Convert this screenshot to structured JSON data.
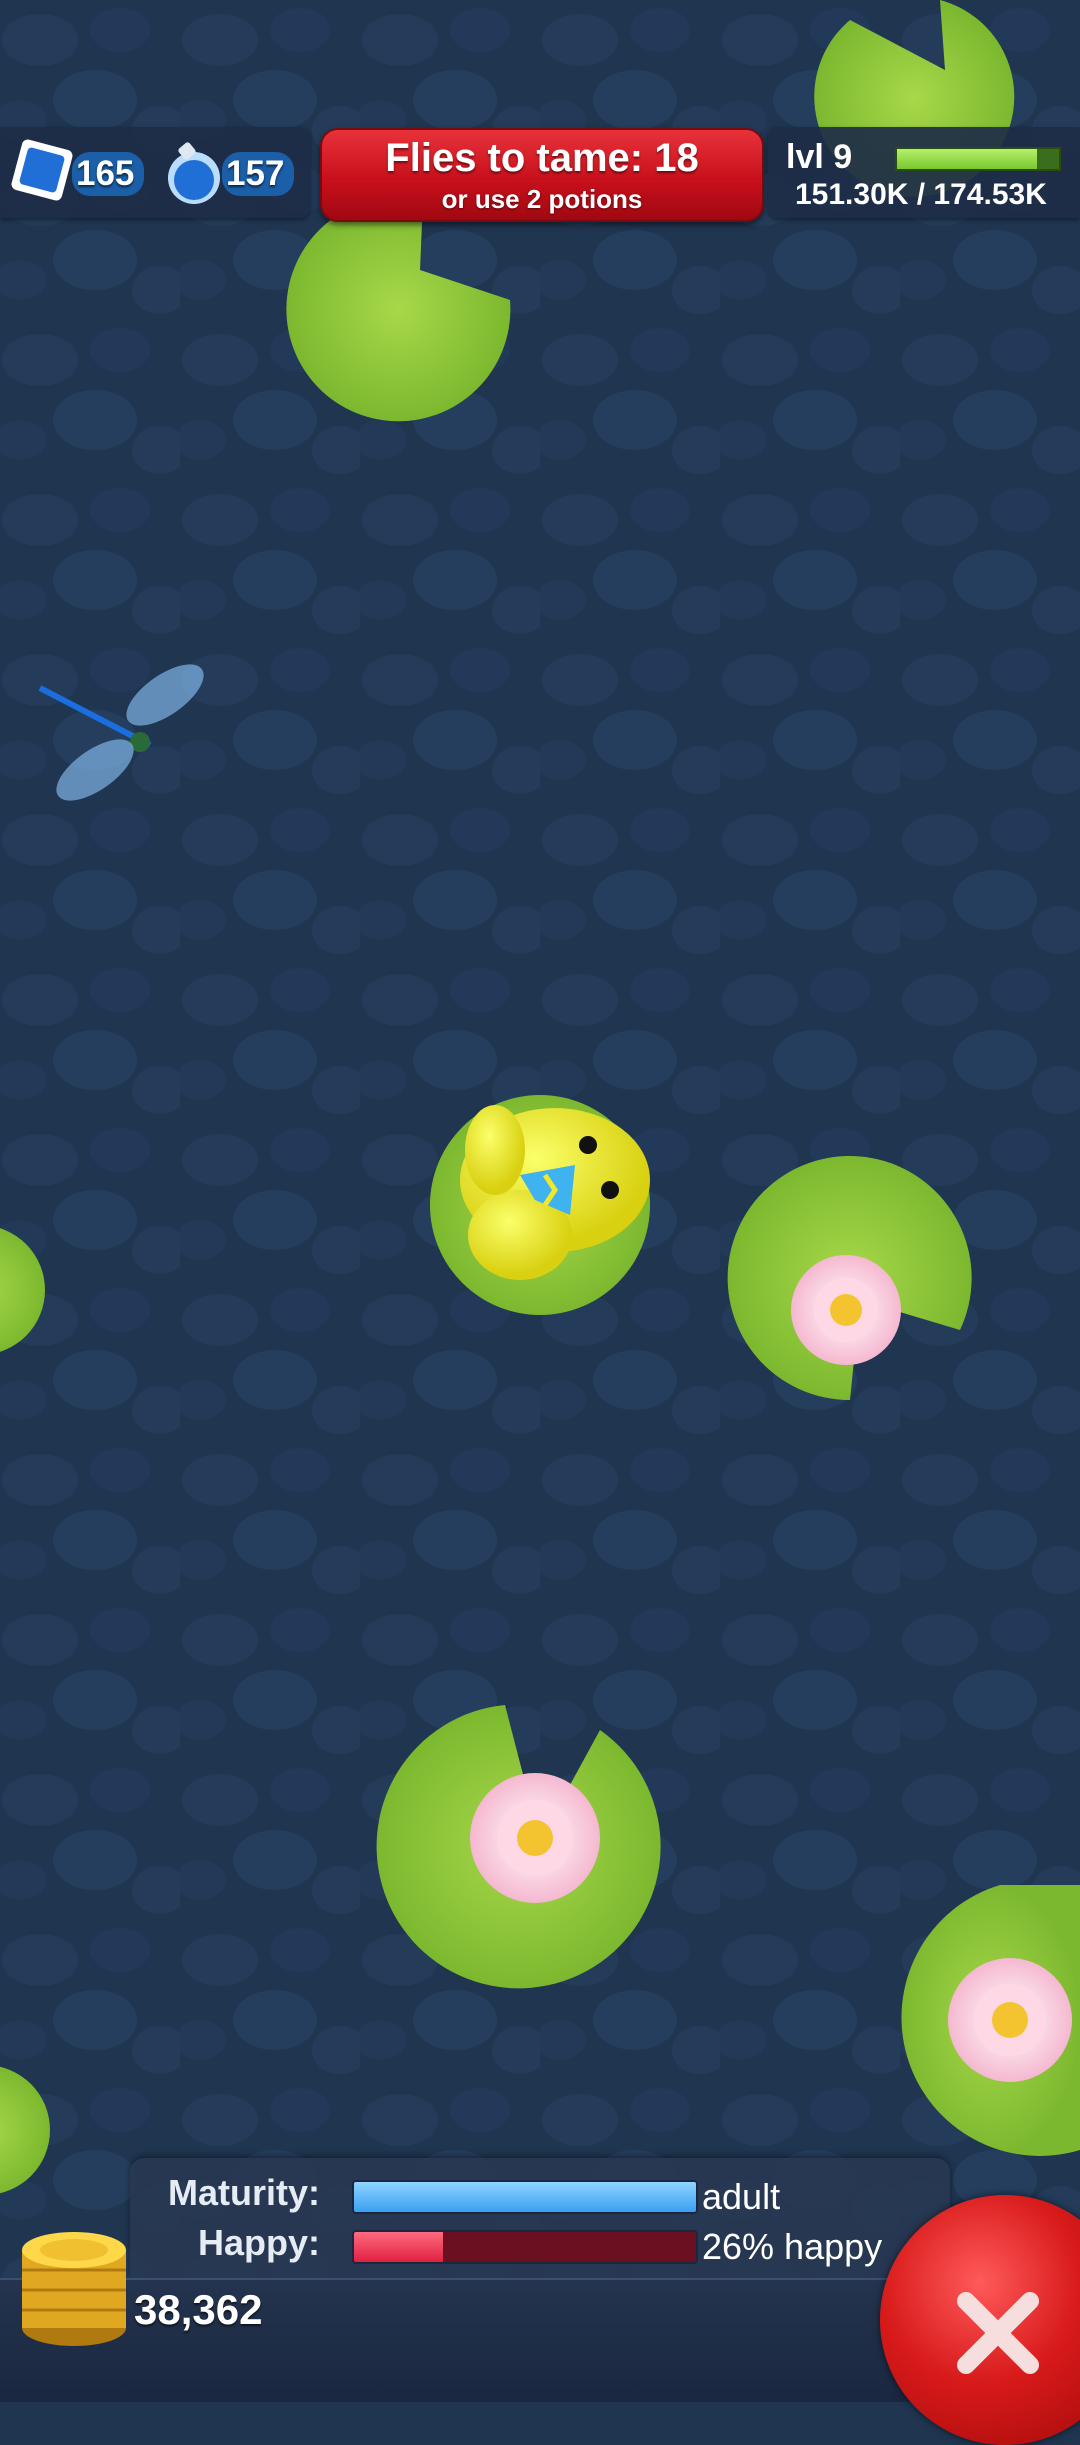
{
  "currency": {
    "gems": "165",
    "potions": "157"
  },
  "tame_banner": {
    "title": "Flies to tame: 18",
    "subtitle": "or use 2 potions",
    "color": "#d81a22"
  },
  "level": {
    "label": "lvl 9",
    "xp_text": "151.30K / 174.53K",
    "xp_progress": 0.867
  },
  "stats": {
    "maturity_label": "Maturity:",
    "maturity_value": "adult",
    "maturity_progress": 1.0,
    "happy_label": "Happy:",
    "happy_value": "26% happy",
    "happy_progress": 0.26
  },
  "coins": {
    "count": "38,362"
  },
  "icons": {
    "gem": "blue-gem-icon",
    "potion": "potion-bottle-icon",
    "coins": "gold-coin-stack-icon",
    "close": "close-x-icon"
  },
  "colors": {
    "water": "#1f3550",
    "lily_pad": "#8bc34a",
    "frog": "#f2e829",
    "accent_red": "#d81a1a"
  }
}
